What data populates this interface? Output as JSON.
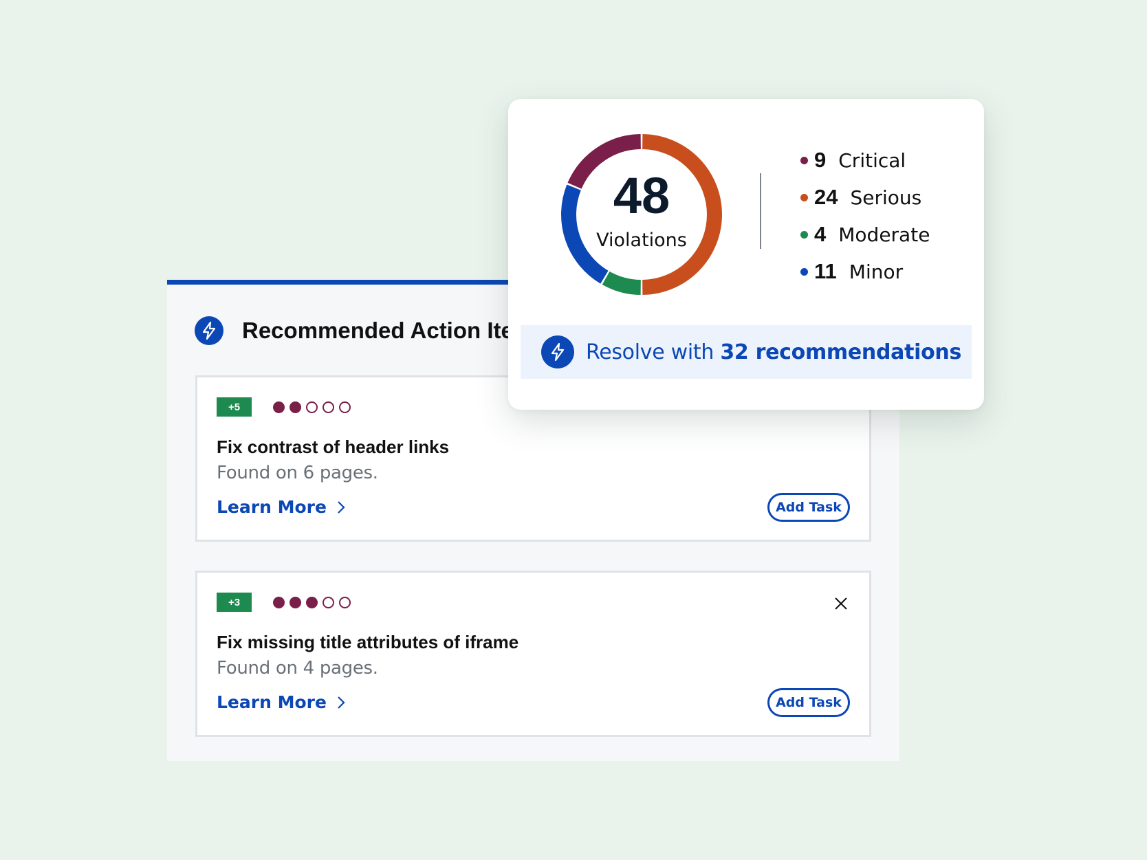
{
  "panel": {
    "title": "Recommended Action Items"
  },
  "cards": [
    {
      "score": "+5",
      "severity_filled": 2,
      "severity_total": 5,
      "title": "Fix contrast of header links",
      "subtitle": "Found on 6 pages.",
      "learn_more": "Learn More",
      "add_task": "Add Task",
      "closable": false
    },
    {
      "score": "+3",
      "severity_filled": 3,
      "severity_total": 5,
      "title": "Fix missing title attributes of iframe",
      "subtitle": "Found on 4 pages.",
      "learn_more": "Learn More",
      "add_task": "Add Task",
      "closable": true
    }
  ],
  "summary": {
    "total": "48",
    "total_label": "Violations",
    "resolve_prefix": "Resolve with ",
    "resolve_emphasis": "32 recommendations",
    "legend": [
      {
        "count": "9",
        "label": "Critical",
        "color": "#7a1f4a"
      },
      {
        "count": "24",
        "label": "Serious",
        "color": "#c84f1d"
      },
      {
        "count": "4",
        "label": "Moderate",
        "color": "#1d8a4f"
      },
      {
        "count": "11",
        "label": "Minor",
        "color": "#0b47b5"
      }
    ]
  },
  "colors": {
    "accent": "#0b47b5",
    "score_green": "#1d8a4f",
    "severity_dot": "#7a1f4a",
    "background": "#e9f3ec"
  },
  "icons": {
    "panel_header": "lightning-bolt-icon",
    "resolve": "lightning-bolt-icon",
    "learn_more": "chevron-right-icon",
    "close": "close-icon"
  }
}
